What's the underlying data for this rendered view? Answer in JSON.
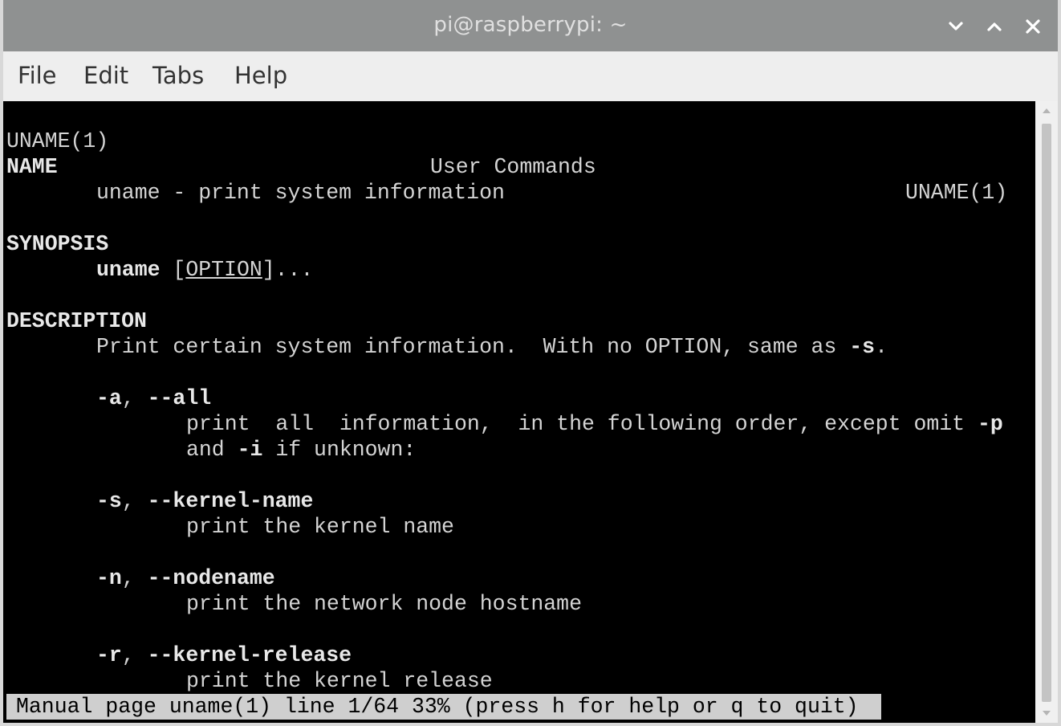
{
  "window": {
    "title": "pi@raspberrypi: ~"
  },
  "menubar": {
    "items": [
      {
        "label": "File"
      },
      {
        "label": "Edit"
      },
      {
        "label": "Tabs"
      },
      {
        "label": "Help"
      }
    ]
  },
  "manpage": {
    "header_left": "UNAME(1)",
    "header_center": "User Commands",
    "header_right": "UNAME(1)",
    "section_name": "NAME",
    "name_line": "uname - print system information",
    "section_synopsis": "SYNOPSIS",
    "synopsis_cmd": "uname",
    "synopsis_open": " [",
    "synopsis_option": "OPTION",
    "synopsis_close": "]...",
    "section_description": "DESCRIPTION",
    "desc_text": "Print certain system information.  With no OPTION, same as ",
    "desc_flag": "-s",
    "desc_end": ".",
    "opt_a_short": "-a",
    "opt_a_sep": ", ",
    "opt_a_long": "--all",
    "opt_a_line1_text": "print  all  information,  in the following order, except omit ",
    "opt_a_line1_flag": "-p",
    "opt_a_line2_pre": "and ",
    "opt_a_line2_flag": "-i",
    "opt_a_line2_post": " if unknown:",
    "opt_s_short": "-s",
    "opt_s_sep": ", ",
    "opt_s_long": "--kernel-name",
    "opt_s_desc": "print the kernel name",
    "opt_n_short": "-n",
    "opt_n_sep": ", ",
    "opt_n_long": "--nodename",
    "opt_n_desc": "print the network node hostname",
    "opt_r_short": "-r",
    "opt_r_sep": ", ",
    "opt_r_long": "--kernel-release",
    "opt_r_desc": "print the kernel release"
  },
  "status": {
    "text": "Manual page uname(1) line 1/64 33% (press h for help or q to quit)"
  },
  "icons": {
    "minimize": "chevron-down-icon",
    "maximize": "chevron-up-icon",
    "close": "close-icon"
  },
  "colors": {
    "titlebar": "#8f9191",
    "menubar": "#eeeeee",
    "terminal_bg": "#000000",
    "terminal_fg": "#d4d4d4",
    "status_bg": "#cfcfcf"
  }
}
